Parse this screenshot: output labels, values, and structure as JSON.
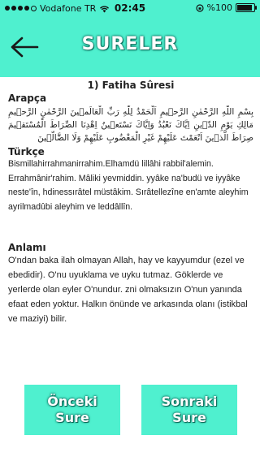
{
  "status_bar": {
    "carrier": "Vodafone TR",
    "time": "02:45",
    "battery_text": "%100",
    "battery_level": 1.0,
    "signal_bars": 4
  },
  "nav": {
    "title": "SURELER",
    "back_icon": "arrow-left-icon"
  },
  "sure": {
    "title": "1) Fatiha Sûresi",
    "arabic_label": "Arapça",
    "arabic_text": "بِسْمِ اللّٰهِ الرَّحْمٰنِ الرَّح۪يمِ اَلْحَمْدُ لِلّٰهِ رَبِّ الْعَالَم۪ينَ الرَّحْمٰنِ الرَّح۪يمِ مَالِكِ يَوْمِ الدّ۪ينِ اِيَّاكَ نَعْبُدُ وَاِيَّاكَ نَسْتَع۪ينُ اِهْدِنَا الصِّرَاطَ الْمُسْتَق۪يمَ صِرَاطَ الَّذ۪ينَ اَنْعَمْتَ عَلَيْهِمْ غَيْرِ الْمَغْضُوبِ عَلَيْهِمْ وَلَا الضَّٓالّ۪ينَ",
    "turkish_label": "Türkçe",
    "turkish_text": "Bismillahirrahmanirrahim.Elhamdü lillâhi rabbil'alemin. Errahmânir'rahim. Mâliki yevmiddin. yyâke na'budü ve iyyâke neste'în, hdinessırâtel müstâkim. Sırâtellezîne en'amte aleyhim ayrilmadûbi aleyhim ve leddâllîn.",
    "meaning_label": "Anlamı",
    "meaning_text": "O'ndan baka ilah olmayan Allah, hay ve kayyumdur (ezel ve ebedidir). O'nu uyuklama ve uyku tutmaz. Göklerde ve yerlerde olan eyler O'nundur. zni olmaksızın O'nun yanında efaat eden yoktur. Halkın önünde ve arkasında olanı (istikbal ve maziyi) bilir."
  },
  "buttons": {
    "prev_line1": "Önceki",
    "prev_line2": "Sure",
    "next_line1": "Sonraki",
    "next_line2": "Sure"
  },
  "colors": {
    "accent": "#4ff0cf",
    "text_outline": "#0d6b5a"
  }
}
